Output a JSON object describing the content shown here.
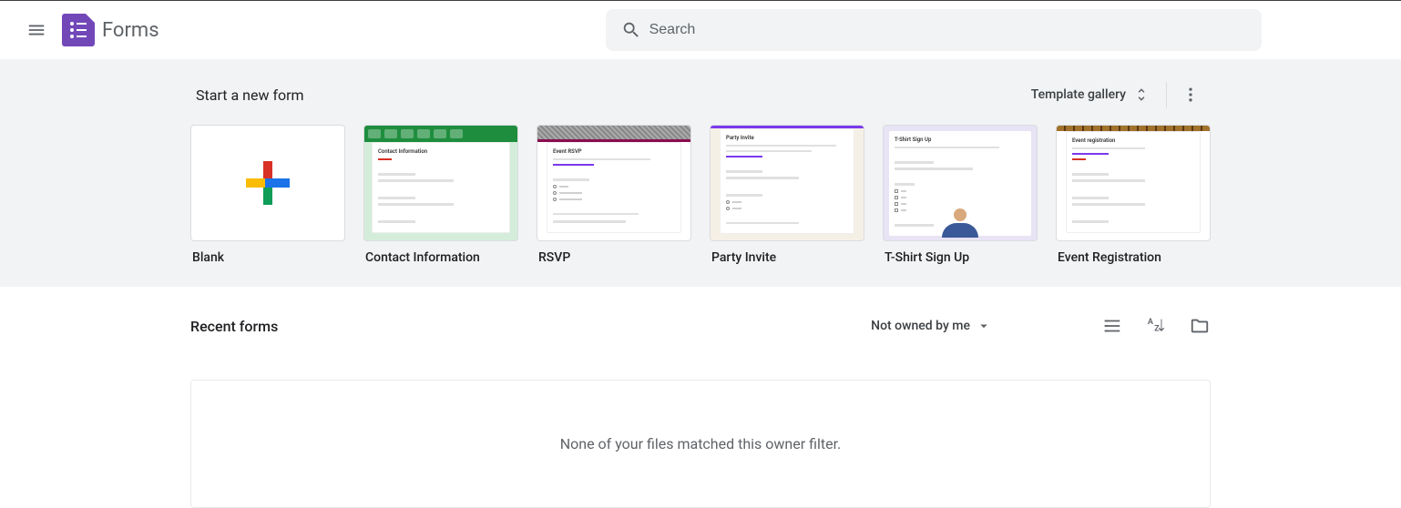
{
  "header": {
    "product_name": "Forms",
    "search_placeholder": "Search"
  },
  "templates": {
    "title": "Start a new form",
    "gallery_label": "Template gallery",
    "cards": [
      {
        "label": "Blank",
        "preview_title": ""
      },
      {
        "label": "Contact Information",
        "preview_title": "Contact Information"
      },
      {
        "label": "RSVP",
        "preview_title": "Event RSVP"
      },
      {
        "label": "Party Invite",
        "preview_title": "Party Invite"
      },
      {
        "label": "T-Shirt Sign Up",
        "preview_title": "T-Shirt Sign Up"
      },
      {
        "label": "Event Registration",
        "preview_title": "Event registration"
      }
    ]
  },
  "recent": {
    "title": "Recent forms",
    "filter_label": "Not owned by me",
    "empty_message": "None of your files matched this owner filter."
  }
}
